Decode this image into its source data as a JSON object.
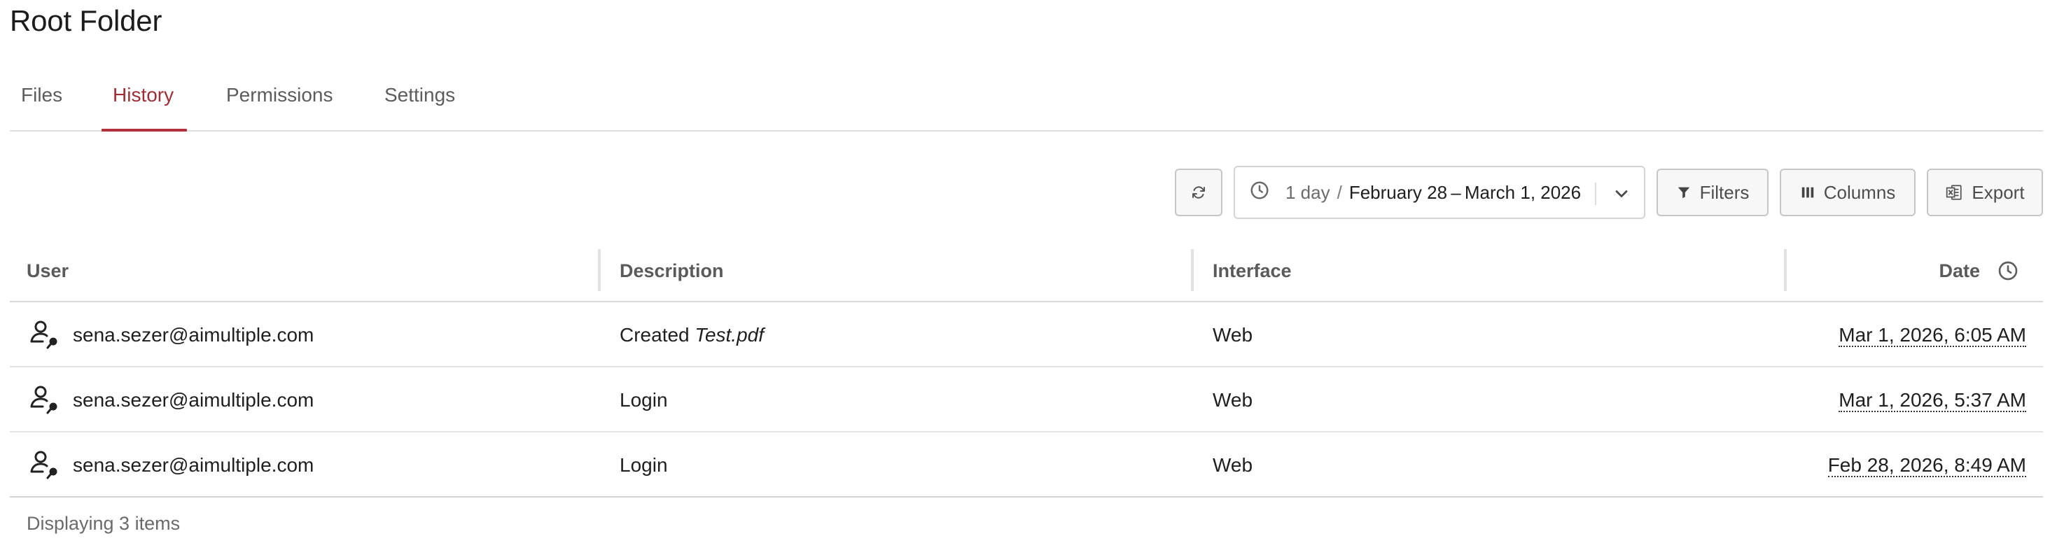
{
  "page": {
    "title": "Root Folder"
  },
  "tabs": [
    {
      "label": "Files",
      "active": false
    },
    {
      "label": "History",
      "active": true
    },
    {
      "label": "Permissions",
      "active": false
    },
    {
      "label": "Settings",
      "active": false
    }
  ],
  "toolbar": {
    "refresh_icon": "refresh-icon",
    "range": {
      "preset": "1 day",
      "separator": "/",
      "dates": "February 28 – March 1, 2026"
    },
    "filters_label": "Filters",
    "columns_label": "Columns",
    "export_label": "Export"
  },
  "table": {
    "columns": {
      "user": "User",
      "description": "Description",
      "interface": "Interface",
      "date": "Date"
    },
    "rows": [
      {
        "user": "sena.sezer@aimultiple.com",
        "desc_action": "Created",
        "desc_file": "Test.pdf",
        "interface": "Web",
        "date": "Mar 1, 2026, 6:05 AM"
      },
      {
        "user": "sena.sezer@aimultiple.com",
        "desc_action": "Login",
        "desc_file": "",
        "interface": "Web",
        "date": "Mar 1, 2026, 5:37 AM"
      },
      {
        "user": "sena.sezer@aimultiple.com",
        "desc_action": "Login",
        "desc_file": "",
        "interface": "Web",
        "date": "Feb 28, 2026, 8:49 AM"
      }
    ]
  },
  "footer": {
    "status": "Displaying 3 items"
  },
  "colors": {
    "accent": "#b1323c",
    "active_tab_text": "#9e2f37"
  }
}
